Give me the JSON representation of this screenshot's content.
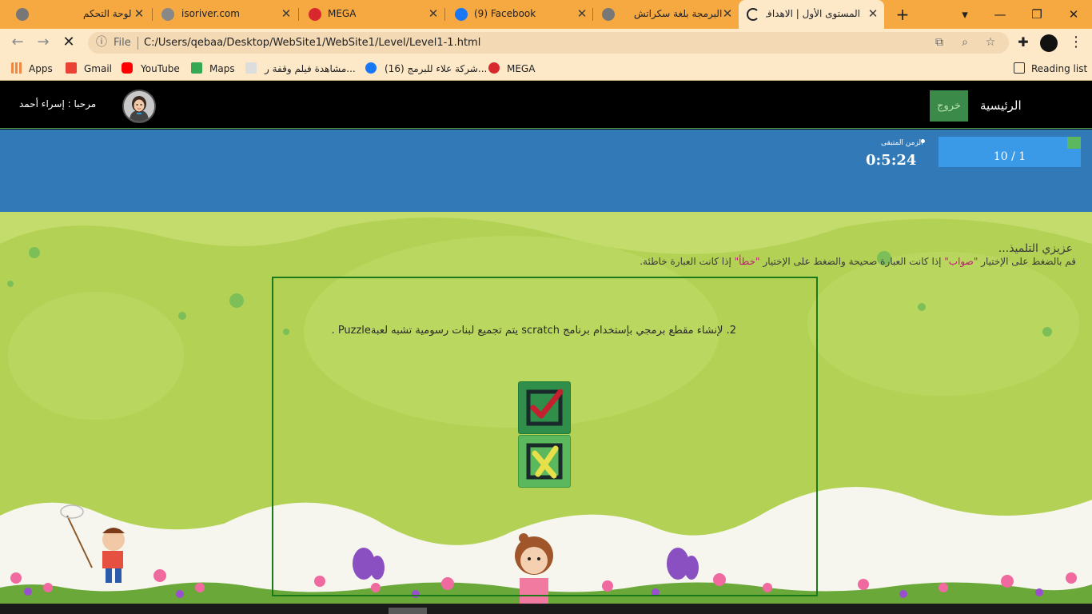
{
  "browser": {
    "tabs": [
      {
        "title": "لوحة التحكم",
        "icon": "globe-icon"
      },
      {
        "title": "isoriver.com",
        "icon": "check-circle-icon"
      },
      {
        "title": "MEGA",
        "icon": "mega-icon"
      },
      {
        "title": "(9) Facebook",
        "icon": "facebook-icon"
      },
      {
        "title": "البرمجة بلغة سكراتش",
        "icon": "globe-icon"
      },
      {
        "title": "المستوى الأول | الاهداف",
        "icon": "loading-spinner-icon"
      }
    ],
    "new_tab": "+",
    "address": {
      "scheme_label": "File",
      "url": "C:/Users/qebaa/Desktop/WebSite1/WebSite1/Level/Level1-1.html"
    },
    "bookmarks": [
      {
        "label": "Apps",
        "icon": "apps-grid-icon"
      },
      {
        "label": "Gmail",
        "icon": "gmail-icon"
      },
      {
        "label": "YouTube",
        "icon": "youtube-icon"
      },
      {
        "label": "Maps",
        "icon": "maps-icon"
      },
      {
        "label": "مشاهدة فيلم وقفة ر...",
        "icon": "site-icon"
      },
      {
        "label": "(16) شركة علاء للبرمج...",
        "icon": "facebook-icon"
      },
      {
        "label": "MEGA",
        "icon": "mega-icon"
      }
    ],
    "reading_list": "Reading list"
  },
  "site": {
    "nav": {
      "home": "الرئيسية",
      "logout": "خروج",
      "greeting": "مرحبا : إسراء أحمد"
    },
    "timer": {
      "label": "الزمن المتبقى",
      "value": "0:5:24"
    },
    "progress": "10 / 1",
    "instructions": {
      "title": "عزيزي التلميذ...",
      "prefix": "قم بالضغط على الإختيار ",
      "true_word": "\"صواب\"",
      "middle": " إذا كانت العبارة صحيحة والضغط على الإختيار ",
      "false_word": "\"خطأ\"",
      "suffix": " إذا كانت العبارة خاطئة."
    },
    "question": "2. لإنشاء مقطع برمجي بإستخدام برنامج scratch يتم تجميع لبنات رسومية تشبه لعبةPuzzle .",
    "colors": {
      "navbar": "#000000",
      "timebar": "#3279b8",
      "scene": "#b3d255",
      "true_button": "#2f8f4a",
      "false_button": "#5cb85c",
      "keyword": "#c2187a"
    }
  }
}
